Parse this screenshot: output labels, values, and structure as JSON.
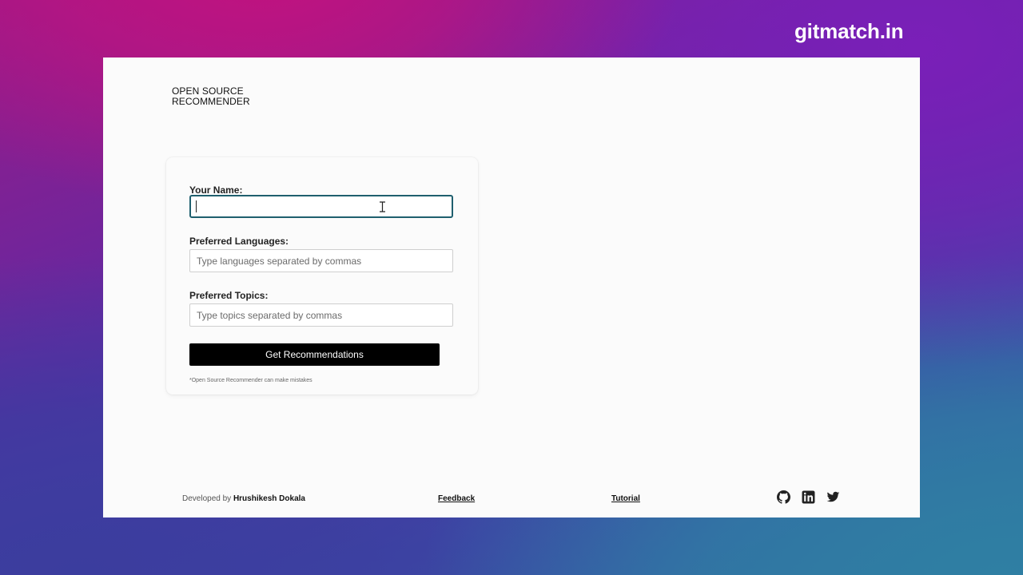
{
  "brand": "gitmatch.in",
  "app": {
    "logo_line1": "OPEN SOURCE",
    "logo_line2": "RECOMMENDER"
  },
  "form": {
    "name_label": "Your Name:",
    "name_value": "",
    "languages_label": "Preferred Languages:",
    "languages_placeholder": "Type languages separated by commas",
    "topics_label": "Preferred Topics:",
    "topics_placeholder": "Type topics separated by commas",
    "submit_label": "Get Recommendations",
    "disclaimer": "*Open Source Recommender can make mistakes"
  },
  "footer": {
    "credit_prefix": "Developed by ",
    "credit_name": "Hrushikesh Dokala",
    "feedback_label": "Feedback",
    "tutorial_label": "Tutorial",
    "social_icons": [
      "github-icon",
      "linkedin-icon",
      "twitter-icon"
    ]
  },
  "colors": {
    "focus_border": "#1f5f6e",
    "button_bg": "#000000",
    "panel_bg": "#fbfbfb"
  }
}
